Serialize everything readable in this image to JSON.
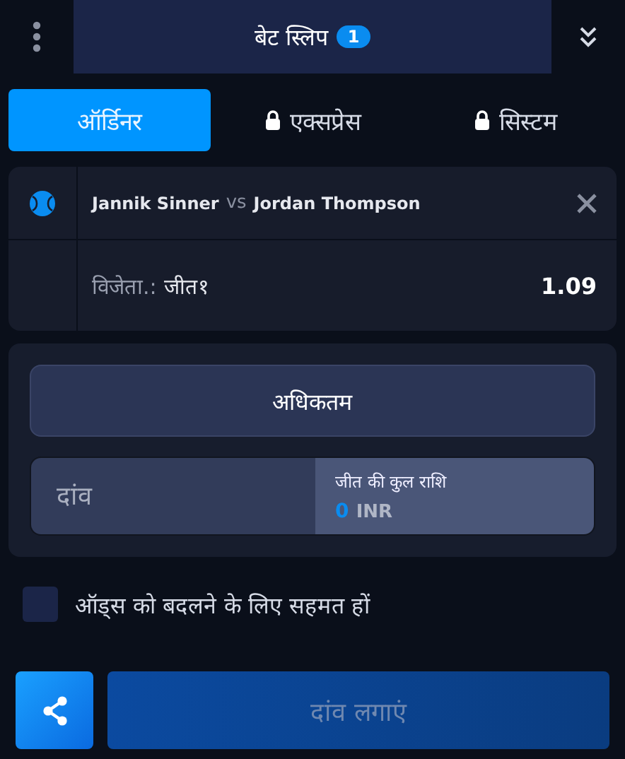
{
  "header": {
    "title": "बेट स्लिप",
    "count": "1"
  },
  "tabs": [
    {
      "label": "ऑर्डिनर",
      "locked": false,
      "selected": true
    },
    {
      "label": "एक्सप्रेस",
      "locked": true,
      "selected": false
    },
    {
      "label": "सिस्टम",
      "locked": true,
      "selected": false
    }
  ],
  "bet": {
    "team1": "Jannik Sinner",
    "vs": "vs",
    "team2": "Jordan Thompson",
    "market_label": "विजेता.:",
    "market_value": "जीत१",
    "odds": "1.09"
  },
  "max_button": "अधिकतम",
  "stake": {
    "placeholder": "दांव",
    "win_label": "जीत की कुल राशि",
    "win_amount": "0",
    "currency": "INR"
  },
  "accept_odds": {
    "label": "ऑड्स को बदलने के लिए सहमत हों",
    "checked": false
  },
  "place_button": {
    "label": "दांव लगाएं",
    "disabled": true
  }
}
